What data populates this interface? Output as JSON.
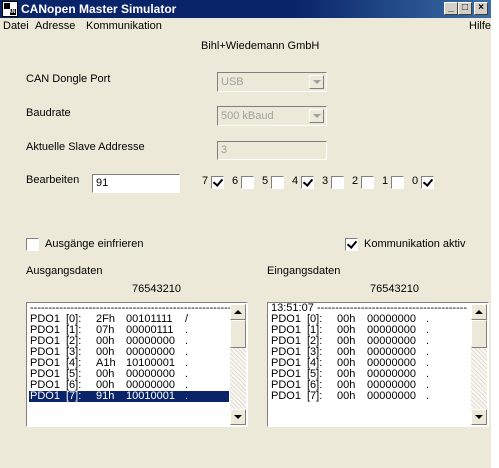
{
  "window": {
    "title": "CANopen Master Simulator",
    "icon_text": "CAN"
  },
  "titlebar_buttons": {
    "minimize": "_",
    "maximize": "□",
    "close": "×"
  },
  "menu": {
    "items": [
      "Datei",
      "Adresse",
      "Kommunikation"
    ],
    "help": "Hilfe"
  },
  "company": "Bihl+Wiedemann GmbH",
  "form": {
    "port_label": "CAN Dongle Port",
    "port_value": "USB",
    "baud_label": "Baudrate",
    "baud_value": "500 kBaud",
    "slave_label": "Aktuelle Slave Addresse",
    "slave_value": "3",
    "edit_label": "Bearbeiten",
    "edit_value": "91"
  },
  "bits": [
    {
      "label": "7",
      "checked": true
    },
    {
      "label": "6",
      "checked": false
    },
    {
      "label": "5",
      "checked": false
    },
    {
      "label": "4",
      "checked": true
    },
    {
      "label": "3",
      "checked": false
    },
    {
      "label": "2",
      "checked": false
    },
    {
      "label": "1",
      "checked": false
    },
    {
      "label": "0",
      "checked": true
    }
  ],
  "freeze_outputs": {
    "label": "Ausgänge einfrieren",
    "checked": false
  },
  "comm_active": {
    "label": "Kommunikation aktiv",
    "checked": true
  },
  "output": {
    "title": "Ausgangsdaten",
    "bit_header": "76543210",
    "first_line": "-------------------------------------------------------",
    "rows": [
      {
        "name": "PDO1",
        "idx": "[0]:",
        "hex": "2Fh",
        "bin": "00101111",
        "ch": "/",
        "selected": false
      },
      {
        "name": "PDO1",
        "idx": "[1]:",
        "hex": "07h",
        "bin": "00000111",
        "ch": ".",
        "selected": false
      },
      {
        "name": "PDO1",
        "idx": "[2]:",
        "hex": "00h",
        "bin": "00000000",
        "ch": ".",
        "selected": false
      },
      {
        "name": "PDO1",
        "idx": "[3]:",
        "hex": "00h",
        "bin": "00000000",
        "ch": ".",
        "selected": false
      },
      {
        "name": "PDO1",
        "idx": "[4]:",
        "hex": "A1h",
        "bin": "10100001",
        "ch": ".",
        "selected": false
      },
      {
        "name": "PDO1",
        "idx": "[5]:",
        "hex": "00h",
        "bin": "00000000",
        "ch": ".",
        "selected": false
      },
      {
        "name": "PDO1",
        "idx": "[6]:",
        "hex": "00h",
        "bin": "00000000",
        "ch": ".",
        "selected": false
      },
      {
        "name": "PDO1",
        "idx": "[7]:",
        "hex": "91h",
        "bin": "10010001",
        "ch": ".",
        "selected": true
      }
    ]
  },
  "input": {
    "title": "Eingangsdaten",
    "bit_header": "76543210",
    "first_line": "13:51:07 -----------------------------------------",
    "rows": [
      {
        "name": "PDO1",
        "idx": "[0]:",
        "hex": "00h",
        "bin": "00000000",
        "ch": ".",
        "selected": false
      },
      {
        "name": "PDO1",
        "idx": "[1]:",
        "hex": "00h",
        "bin": "00000000",
        "ch": ".",
        "selected": false
      },
      {
        "name": "PDO1",
        "idx": "[2]:",
        "hex": "00h",
        "bin": "00000000",
        "ch": ".",
        "selected": false
      },
      {
        "name": "PDO1",
        "idx": "[3]:",
        "hex": "00h",
        "bin": "00000000",
        "ch": ".",
        "selected": false
      },
      {
        "name": "PDO1",
        "idx": "[4]:",
        "hex": "00h",
        "bin": "00000000",
        "ch": ".",
        "selected": false
      },
      {
        "name": "PDO1",
        "idx": "[5]:",
        "hex": "00h",
        "bin": "00000000",
        "ch": ".",
        "selected": false
      },
      {
        "name": "PDO1",
        "idx": "[6]:",
        "hex": "00h",
        "bin": "00000000",
        "ch": ".",
        "selected": false
      },
      {
        "name": "PDO1",
        "idx": "[7]:",
        "hex": "00h",
        "bin": "00000000",
        "ch": ".",
        "selected": false
      }
    ]
  },
  "colors": {
    "titlebar": "#0a246a",
    "selection": "#0a246a",
    "face": "#ece9d8"
  }
}
